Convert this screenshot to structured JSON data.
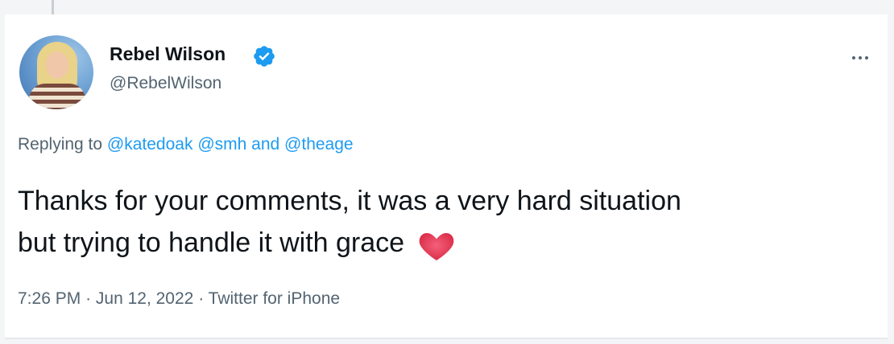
{
  "tweet": {
    "author": {
      "display_name": "Rebel Wilson",
      "handle": "@RebelWilson",
      "verified": true
    },
    "reply": {
      "prefix": "Replying to",
      "mention1": "@katedoak",
      "mention2": "@smh",
      "connector": "and",
      "mention3": "@theage"
    },
    "text": {
      "line1": "Thanks for your comments, it was a very hard situation",
      "line2": "but trying to handle it with grace"
    },
    "meta": {
      "time": "7:26 PM",
      "date": "Jun 12, 2022",
      "source": "Twitter for iPhone",
      "separator": "·"
    }
  },
  "colors": {
    "link": "#1d9bf0",
    "secondary_text": "#536471",
    "primary_text": "#0f1419",
    "heart": "#e8384f"
  },
  "icons": [
    "verified-badge-icon",
    "more-options-icon",
    "red-heart-icon"
  ]
}
